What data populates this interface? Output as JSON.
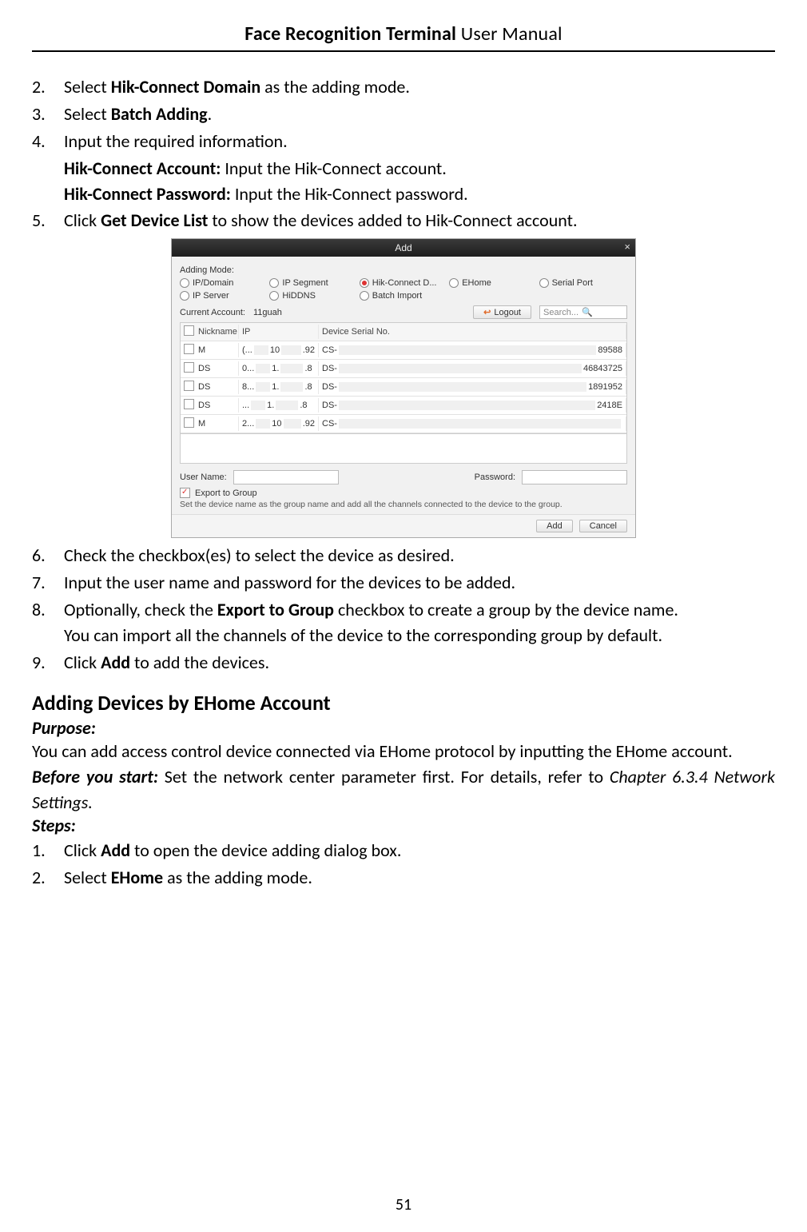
{
  "header": {
    "bold": "Face Recognition Terminal",
    "plain": "  User Manual"
  },
  "page_number": "51",
  "steps_a": [
    {
      "n": "2.",
      "pre": "Select ",
      "b": "Hik-Connect Domain",
      "post": " as the adding mode."
    },
    {
      "n": "3.",
      "pre": "Select ",
      "b": "Batch Adding",
      "post": "."
    },
    {
      "n": "4.",
      "pre": "Input the required information.",
      "b": "",
      "post": ""
    }
  ],
  "step4_lines": [
    {
      "b": "Hik-Connect Account:",
      "post": " Input the Hik-Connect account."
    },
    {
      "b": "Hik-Connect Password:",
      "post": " Input the Hik-Connect password."
    }
  ],
  "step5": {
    "n": "5.",
    "pre": "Click ",
    "b": "Get Device List",
    "post": " to show the devices added to Hik-Connect account."
  },
  "steps_b": [
    {
      "n": "6.",
      "pre": "Check the checkbox(es) to select the device as desired.",
      "b": "",
      "post": ""
    },
    {
      "n": "7.",
      "pre": "Input the user name and password for the devices to be added.",
      "b": "",
      "post": ""
    }
  ],
  "step8": {
    "n": "8.",
    "pre": "Optionally, check the ",
    "b": "Export to Group",
    "post": " checkbox to create a group by the device name.",
    "line2": "You can import all the channels of the device to the corresponding group by default."
  },
  "step9": {
    "n": "9.",
    "pre": "Click ",
    "b": "Add",
    "post": " to add the devices."
  },
  "section_title": "Adding Devices by EHome Account",
  "purpose_label": "Purpose:",
  "purpose_text": "You can add access control device connected via EHome protocol by inputting the EHome account.",
  "before_label": "Before you start:",
  "before_text": " Set the network center parameter first. For details, refer to ",
  "before_ref": "Chapter 6.3.4 Network Settings.",
  "steps_label": "Steps:",
  "steps_c": [
    {
      "n": "1.",
      "pre": "Click ",
      "b": "Add",
      "post": " to open the device adding dialog box."
    },
    {
      "n": "2.",
      "pre": "Select ",
      "b": "EHome",
      "post": " as the adding mode."
    }
  ],
  "dialog": {
    "title": "Add",
    "close": "×",
    "mode_label": "Adding Mode:",
    "radios": [
      "IP/Domain",
      "IP Segment",
      "Hik-Connect D...",
      "EHome",
      "Serial Port",
      "IP Server",
      "HiDDNS",
      "Batch Import"
    ],
    "selected_radio_index": 2,
    "current_account_label": "Current Account:",
    "current_account_value": "11guah",
    "logout_label": "Logout",
    "search_placeholder": "Search...",
    "columns": [
      "",
      "Nickname",
      "IP",
      "Device Serial No."
    ],
    "rows": [
      {
        "nick": "M",
        "ip_a": "(...",
        "ip_b": "10",
        "ip_c": ".92",
        "serial_pre": "CS-",
        "serial_tail": "89588"
      },
      {
        "nick": "DS",
        "ip_a": "0...",
        "ip_b": "1.",
        "ip_c": ".8",
        "serial_pre": "DS-",
        "serial_tail": "46843725"
      },
      {
        "nick": "DS",
        "ip_a": "8...",
        "ip_b": "1.",
        "ip_c": ".8",
        "serial_pre": "DS-",
        "serial_tail": "1891952"
      },
      {
        "nick": "DS",
        "ip_a": "...",
        "ip_b": "1.",
        "ip_c": ".8",
        "serial_pre": "DS-",
        "serial_tail": "2418E"
      },
      {
        "nick": "M",
        "ip_a": "2...",
        "ip_b": "10",
        "ip_c": ".92",
        "serial_pre": "CS-",
        "serial_tail": ""
      }
    ],
    "user_label": "User Name:",
    "pass_label": "Password:",
    "export_label": "Export to Group",
    "export_hint": "Set the device name as the group name and add all the channels connected to the device to the group.",
    "add_btn": "Add",
    "cancel_btn": "Cancel"
  }
}
